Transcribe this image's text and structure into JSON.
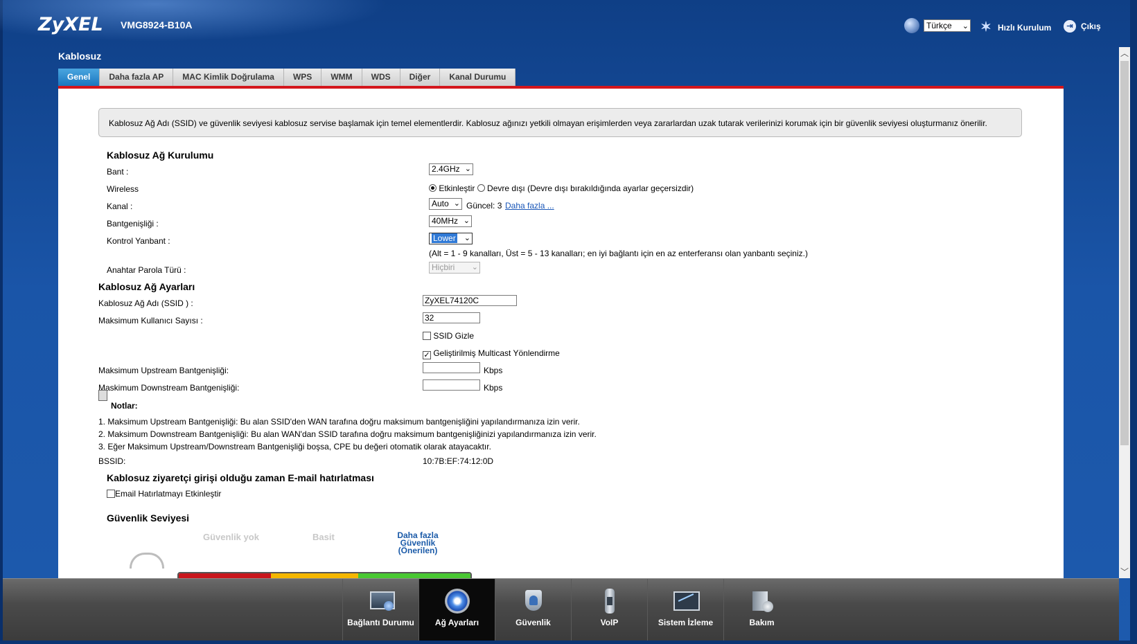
{
  "header": {
    "logo": "ZyXEL",
    "model": "VMG8924-B10A",
    "language": "Türkçe",
    "quick_setup": "Hızlı Kurulum",
    "logout": "Çıkış"
  },
  "page": {
    "title": "Kablosuz",
    "tabs": [
      "Genel",
      "Daha fazla AP",
      "MAC Kimlik Doğrulama",
      "WPS",
      "WMM",
      "WDS",
      "Diğer",
      "Kanal Durumu"
    ],
    "active_tab": "Genel",
    "info": "Kablosuz Ağ Adı (SSID) ve güvenlik seviyesi kablosuz servise başlamak için temel elementlerdir. Kablosuz ağınızı yetkili olmayan erişimlerden veya zararlardan uzak tutarak verilerinizi korumak için bir güvenlik seviyesi oluşturmanız önerilir."
  },
  "setup": {
    "heading": "Kablosuz Ağ Kurulumu",
    "band_label": "Bant :",
    "band_value": "2.4GHz",
    "wireless_label": "Wireless",
    "enable_label": "Etkinleştir",
    "disable_label": "Devre dışı (Devre dışı bırakıldığında ayarlar geçersizdir)",
    "channel_label": "Kanal :",
    "channel_value": "Auto",
    "current_channel": "Güncel: 3",
    "more_link": "Daha fazla ...",
    "bandwidth_label": "Bantgenişliği :",
    "bandwidth_value": "40MHz",
    "sideband_label": "Kontrol Yanbant :",
    "sideband_value": "Lower",
    "sideband_note": "(Alt = 1 - 9 kanalları, Üst = 5 - 13 kanalları; en iyi bağlantı için en az enterferansı olan yanbantı seçiniz.)",
    "passphrase_type_label": "Anahtar Parola Türü :",
    "passphrase_type_value": "Hiçbiri"
  },
  "network": {
    "heading": "Kablosuz Ağ Ayarları",
    "ssid_label": "Kablosuz Ağ Adı (SSID ) :",
    "ssid_value": "ZyXEL74120C",
    "max_users_label": "Maksimum Kullanıcı Sayısı :",
    "max_users_value": "32",
    "hide_ssid_label": "SSID Gizle",
    "multicast_label": "Geliştirilmiş Multicast Yönlendirme",
    "upstream_label": "Maksimum Upstream Bantgenişliği:",
    "downstream_label": "Maskimum Downstream Bantgenişliği:",
    "unit": "Kbps",
    "notes_title": "Notlar:",
    "notes": [
      "1. Maksimum Upstream Bantgenişliği: Bu alan SSID'den WAN tarafına doğru maksimum bantgenişliğini yapılandırmanıza izin verir.",
      "2. Maksimum Downstream Bantgenişliği: Bu alan WAN'dan SSID tarafına doğru maksimum bantgenişliğinizi yapılandırmanıza izin verir.",
      "3. Eğer Maksimum Upstream/Downstream Bantgenişliği boşsa, CPE bu değeri otomatik olarak atayacaktır."
    ],
    "bssid_label": "BSSID:",
    "bssid_value": "10:7B:EF:74:12:0D"
  },
  "email": {
    "heading": "Kablosuz ziyaretçi girişi olduğu zaman E-mail hatırlatması",
    "enable_label": "Email Hatırlatmayı Etkinleştir"
  },
  "security": {
    "heading": "Güvenlik Seviyesi",
    "level_none": "Güvenlik yok",
    "level_basic": "Basit",
    "level_more_1": "Daha fazla",
    "level_more_2": "Güvenlik",
    "level_more_3": "(Önerilen)"
  },
  "bottom_nav": [
    {
      "label": "Bağlantı Durumu",
      "icon": "monitor-icon"
    },
    {
      "label": "Ağ Ayarları",
      "icon": "network-gear-icon"
    },
    {
      "label": "Güvenlik",
      "icon": "shield-icon"
    },
    {
      "label": "VoIP",
      "icon": "phone-icon"
    },
    {
      "label": "Sistem İzleme",
      "icon": "chart-monitor-icon"
    },
    {
      "label": "Bakım",
      "icon": "maintenance-icon"
    }
  ],
  "colors": {
    "accent_red": "#d4161c",
    "tab_active": "#1a76bf",
    "link": "#1a57b8",
    "security_red": "#c8161c",
    "security_yellow": "#f5b700",
    "security_green": "#49c832"
  }
}
